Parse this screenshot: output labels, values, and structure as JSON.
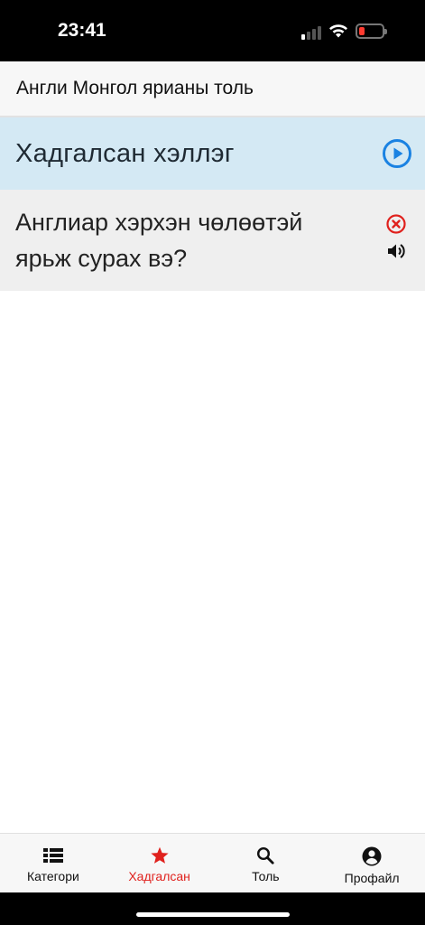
{
  "status": {
    "time": "23:41"
  },
  "header": {
    "title": "Англи Монгол ярианы толь"
  },
  "saved_section": {
    "title": "Хадгалсан хэллэг",
    "play_icon": "play-circle-icon",
    "accent": "#1a82e2",
    "background": "#d4e9f4"
  },
  "phrases": [
    {
      "text": "Англиар хэрхэн чөлөөтэй ярьж сурах вэ?",
      "delete_icon": "close-circle-icon",
      "speaker_icon": "volume-icon"
    }
  ],
  "tabs": [
    {
      "label": "Категори",
      "icon": "list-icon",
      "active": false
    },
    {
      "label": "Хадгалсан",
      "icon": "star-icon",
      "active": true
    },
    {
      "label": "Толь",
      "icon": "search-icon",
      "active": false
    },
    {
      "label": "Профайл",
      "icon": "account-circle-icon",
      "active": false
    }
  ],
  "colors": {
    "active_tab": "#e0211d",
    "delete": "#e0211d"
  }
}
